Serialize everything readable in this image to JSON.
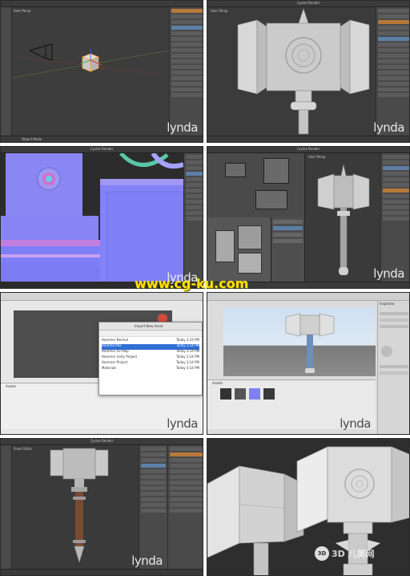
{
  "panels": [
    {
      "id": "p1",
      "viewport_label": "User Persp",
      "mode_label": "Object Mode",
      "watermark": "lynda"
    },
    {
      "id": "p2",
      "viewport_label": "User Persp",
      "header_title": "Cycles Render",
      "watermark": "lynda"
    },
    {
      "id": "p3",
      "header_title": "Cycles Render",
      "watermark": "lynda"
    },
    {
      "id": "p4",
      "viewport_label": "User Persp",
      "header_title": "Cycles Render",
      "watermark": "lynda"
    },
    {
      "id": "p5",
      "dialog_title": "Import New Asset",
      "files": [
        {
          "name": "Hammer Normal",
          "meta": "Today 3:14 PM"
        },
        {
          "name": "Hammer.fbx",
          "meta": "Today 3:14 PM"
        },
        {
          "name": "Hammer Uv Map",
          "meta": "Today 3:14 PM"
        },
        {
          "name": "Hammer Unity Project",
          "meta": "Today 3:14 PM"
        },
        {
          "name": "Hammer Project",
          "meta": "Today 3:14 PM"
        },
        {
          "name": "Materials",
          "meta": "Today 3:14 PM"
        }
      ],
      "assets_tab": "Assets",
      "watermark": "lynda"
    },
    {
      "id": "p6",
      "assets_tab": "Assets",
      "inspector_title": "Inspector",
      "watermark": "lynda"
    },
    {
      "id": "p7",
      "viewport_label": "Front Ortho",
      "header_title": "Cycles Render",
      "watermark": "lynda"
    },
    {
      "id": "p8"
    }
  ],
  "site_watermark": "www.cg-ku.com",
  "corner_logo": "3D",
  "corner_logo_text": "3D 儿美网",
  "colors": {
    "blender_bg": "#3d3d3d",
    "normal_blue": "#8080ff",
    "unity_sky": "#d7e6f5",
    "watermark_yellow": "#ffe400"
  }
}
